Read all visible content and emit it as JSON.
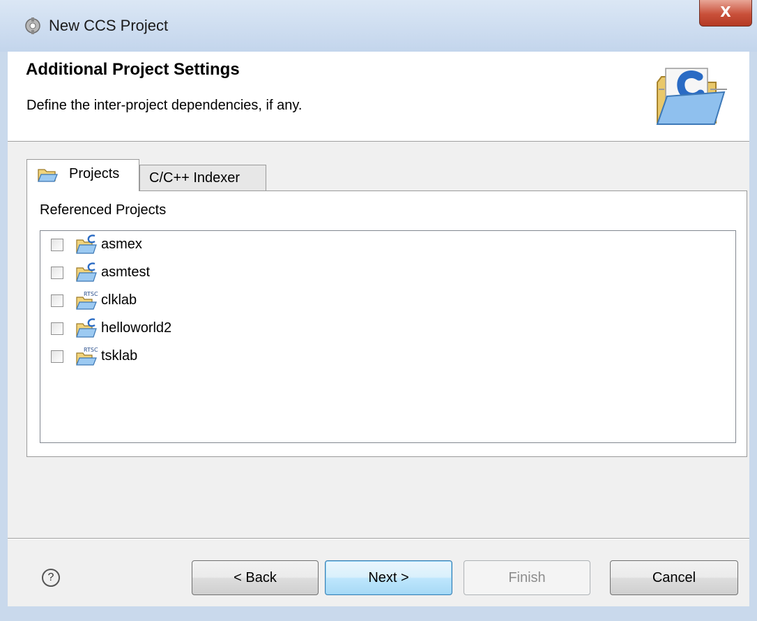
{
  "window": {
    "title": "New CCS Project",
    "close_label": "X"
  },
  "header": {
    "title": "Additional Project Settings",
    "description": "Define the inter-project dependencies, if any."
  },
  "tabs": [
    {
      "label": "Projects",
      "icon": "folder-open-icon",
      "selected": true
    },
    {
      "label": "C/C++ Indexer",
      "selected": false
    }
  ],
  "referenced_projects": {
    "label": "Referenced Projects",
    "items": [
      {
        "label": "asmex",
        "icon": "c-project-icon",
        "checked": false
      },
      {
        "label": "asmtest",
        "icon": "c-project-icon",
        "checked": false
      },
      {
        "label": "clklab",
        "icon": "rtsc-project-icon",
        "checked": false
      },
      {
        "label": "helloworld2",
        "icon": "c-project-icon",
        "checked": false
      },
      {
        "label": "tsklab",
        "icon": "rtsc-project-icon",
        "checked": false
      }
    ]
  },
  "footer": {
    "help_glyph": "?",
    "back_label": "< Back",
    "next_label": "Next >",
    "finish_label": "Finish",
    "cancel_label": "Cancel"
  }
}
